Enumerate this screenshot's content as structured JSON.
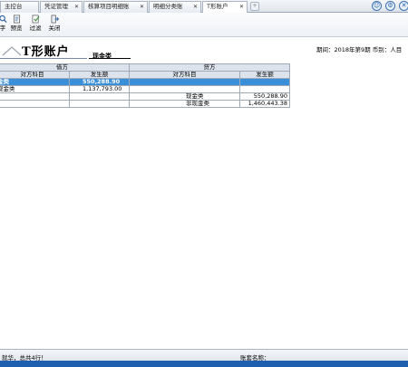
{
  "tabs": [
    {
      "label": "主控台"
    },
    {
      "label": "凭证管理"
    },
    {
      "label": "核算项目明细账"
    },
    {
      "label": "明细分类账"
    },
    {
      "label": "T形账户",
      "active": true
    }
  ],
  "toolbar": {
    "buttons": [
      {
        "label": "字",
        "icon": "print-preview-icon"
      },
      {
        "label": "预览",
        "icon": "preview-icon"
      },
      {
        "label": "过滤",
        "icon": "filter-icon"
      },
      {
        "label": "关闭",
        "icon": "close-door-icon"
      }
    ]
  },
  "header": {
    "title": "T形账户",
    "subject": "现金类",
    "period_text": "期间：2018年第9期  币别：人目"
  },
  "table": {
    "debit_header": "借方",
    "credit_header": "贷方",
    "col_headers": [
      "对方科目",
      "发生额",
      "对方科目",
      "发生额"
    ],
    "rows": [
      {
        "c1": "金类",
        "c2": "550,288.90",
        "c3": "",
        "c4": "",
        "selected": true
      },
      {
        "c1": "现金类",
        "c2": "1,137,793.00",
        "c3": "",
        "c4": "",
        "selected": false
      },
      {
        "c1": "",
        "c2": "",
        "c3": "现金类",
        "c4": "550,288.90",
        "selected": false
      },
      {
        "c1": "",
        "c2": "",
        "c3": "非现金类",
        "c4": "1,460,443.38",
        "selected": false
      }
    ]
  },
  "status": {
    "left": "就华，总共4行！",
    "right": "账套名称："
  },
  "colors": {
    "selected_row": "#3b8fd8",
    "header_bg": "#dce3ec",
    "bottom_strip": "#1f5fb0"
  }
}
